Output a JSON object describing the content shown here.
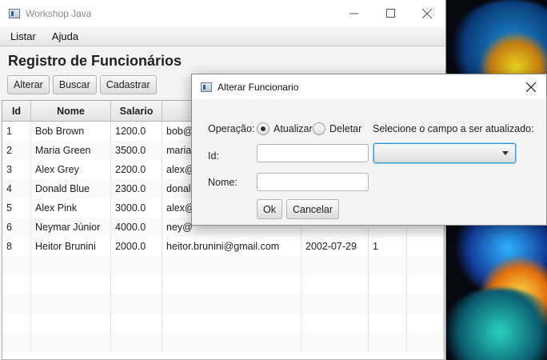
{
  "main_window": {
    "title": "Workshop Java",
    "menu": [
      "Listar",
      "Ajuda"
    ],
    "heading": "Registro de Funcionários",
    "toolbar": {
      "alterar": "Alterar",
      "buscar": "Buscar",
      "cadastrar": "Cadastrar"
    },
    "table": {
      "columns": [
        "Id",
        "Nome",
        "Salario",
        "",
        "",
        "",
        ""
      ],
      "rows": [
        [
          "1",
          "Bob Brown",
          "1200.0",
          "bob@",
          "",
          "",
          ""
        ],
        [
          "2",
          "Maria Green",
          "3500.0",
          "maria@",
          "",
          "",
          ""
        ],
        [
          "3",
          "Alex Grey",
          "2200.0",
          "alex@",
          "",
          "",
          ""
        ],
        [
          "4",
          "Donald Blue",
          "2300.0",
          "donald",
          "",
          "",
          ""
        ],
        [
          "5",
          "Alex Pink",
          "3000.0",
          "alex@",
          "",
          "",
          ""
        ],
        [
          "6",
          "Neymar Júnior",
          "4000.0",
          "ney@",
          "",
          "",
          ""
        ],
        [
          "8",
          "Heitor Brunini",
          "2000.0",
          "heitor.brunini@gmail.com",
          "2002-07-29",
          "1",
          ""
        ]
      ],
      "empty_rows": 5
    }
  },
  "dialog": {
    "title": "Alterar Funcionario",
    "operacao_label": "Operação:",
    "radio_atualizar": "Atualizar",
    "radio_deletar": "Deletar",
    "selected_operation": "Atualizar",
    "campo_label": "Selecione o campo a ser atualizado:",
    "id_label": "Id:",
    "nome_label": "Nome:",
    "id_value": "",
    "nome_value": "",
    "combo_value": "",
    "ok_button": "Ok",
    "cancel_button": "Cancelar"
  },
  "colors": {
    "focus_accent": "#3a94d8"
  }
}
